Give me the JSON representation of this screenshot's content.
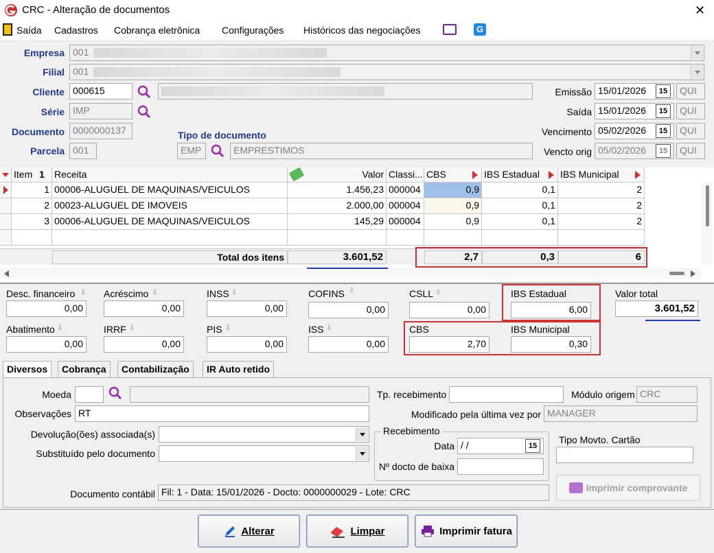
{
  "window": {
    "title": "CRC - Alteração de documentos",
    "close": "✕"
  },
  "menu": [
    "Saída",
    "Cadastros",
    "Cobrança eletrônica",
    "Configurações",
    "Históricos das negociações"
  ],
  "header": {
    "empresa_label": "Empresa",
    "empresa_value": "001",
    "filial_label": "Filial",
    "filial_value": "001",
    "cliente_label": "Cliente",
    "cliente_value": "000615",
    "serie_label": "Série",
    "serie_value": "IMP",
    "documento_label": "Documento",
    "documento_value": "0000000137",
    "parcela_label": "Parcela",
    "parcela_value": "001",
    "tipo_doc_label": "Tipo de documento",
    "tipo_doc_code": "EMP",
    "tipo_doc_desc": "EMPRESTIMOS",
    "emissao_label": "Emissão",
    "emissao_value": "15/01/2026",
    "emissao_day": "QUI",
    "saida_label": "Saída",
    "saida_value": "15/01/2026",
    "saida_day": "QUI",
    "vencimento_label": "Vencimento",
    "vencimento_value": "05/02/2026",
    "vencimento_day": "QUI",
    "vencto_orig_label": "Vencto orig",
    "vencto_orig_value": "05/02/2026",
    "vencto_orig_day": "QUI",
    "cal_glyph": "15"
  },
  "grid": {
    "headers": [
      "Item",
      "Receita",
      "Valor",
      "Classi...",
      "CBS",
      "IBS Estadual",
      "IBS Municipal"
    ],
    "rows": [
      {
        "item": "1",
        "receita": "00006-ALUGUEL DE MAQUINAS/VEICULOS",
        "valor": "1.456,23",
        "classi": "000004",
        "cbs": "0,9",
        "ibs_est": "0,1",
        "ibs_mun": "2"
      },
      {
        "item": "2",
        "receita": "00023-ALUGUEL DE IMOVEIS",
        "valor": "2.000,00",
        "classi": "000004",
        "cbs": "0,9",
        "ibs_est": "0,1",
        "ibs_mun": "2"
      },
      {
        "item": "3",
        "receita": "00006-ALUGUEL DE MAQUINAS/VEICULOS",
        "valor": "145,29",
        "classi": "000004",
        "cbs": "0,9",
        "ibs_est": "0,1",
        "ibs_mun": "2"
      }
    ],
    "total_label": "Total dos itens",
    "total_valor": "3.601,52",
    "total_cbs": "2,7",
    "total_ibs_est": "0,3",
    "total_ibs_mun": "6"
  },
  "totals": {
    "desc_fin_label": "Desc. financeiro",
    "desc_fin": "0,00",
    "acrescimo_label": "Acréscimo",
    "acrescimo": "0,00",
    "inss_label": "INSS",
    "inss": "0,00",
    "cofins_label": "COFINS",
    "cofins": "0,00",
    "csll_label": "CSLL",
    "csll": "0,00",
    "ibs_est_label": "IBS Estadual",
    "ibs_est": "6,00",
    "valor_total_label": "Valor total",
    "valor_total": "3.601,52",
    "abatimento_label": "Abatimento",
    "abatimento": "0,00",
    "irrf_label": "IRRF",
    "irrf": "0,00",
    "pis_label": "PIS",
    "pis": "0,00",
    "iss_label": "ISS",
    "iss": "0,00",
    "cbs_label": "CBS",
    "cbs": "2,70",
    "ibs_mun_label": "IBS Municipal",
    "ibs_mun": "0,30"
  },
  "tabs": [
    "Diversos",
    "Cobrança",
    "Contabilização",
    "IR Auto retido"
  ],
  "diversos": {
    "moeda_label": "Moeda",
    "moeda_value": "",
    "tp_receb_label": "Tp. recebimento",
    "tp_receb_value": "",
    "modulo_label": "Módulo origem",
    "modulo_value": "CRC",
    "obs_label": "Observações",
    "obs_value": "RT",
    "modificado_label": "Modificado pela última vez por",
    "modificado_value": "MANAGER",
    "devolucao_label": "Devolução(ões) associada(s)",
    "substituido_label": "Substituído pelo documento",
    "recebimento_label": "Recebimento",
    "data_label": "Data",
    "data_value": "/ /",
    "ndocto_label": "Nº docto de baixa",
    "tipo_movto_label": "Tipo Movto. Cartão",
    "doc_contabil_label": "Documento contábil",
    "doc_contabil_value": "Fil: 1 - Data: 15/01/2026 - Docto: 0000000029 - Lote: CRC",
    "imprimir_comp_label": "Imprimir comprovante"
  },
  "buttons": {
    "alterar": "Alterar",
    "limpar": "Limpar",
    "imprimir": "Imprimir fatura"
  },
  "colors": {
    "label_blue": "#1f3a8a",
    "highlight_red": "#d32f2f",
    "underline_blue": "#1a3dc8",
    "selected_cell": "#9fc0e8"
  }
}
